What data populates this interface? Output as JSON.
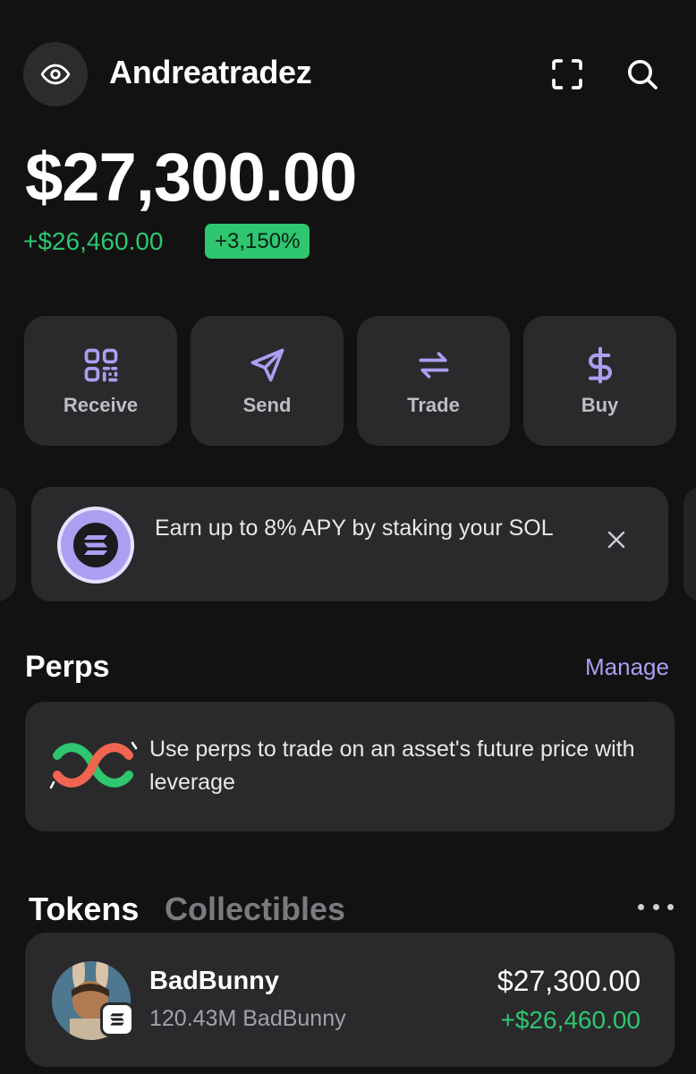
{
  "header": {
    "username": "Andreatradez"
  },
  "balance": {
    "total": "$27,300.00",
    "change_amount": "+$26,460.00",
    "change_percent": "+3,150%"
  },
  "actions": [
    {
      "label": "Receive",
      "icon": "qr-code-icon"
    },
    {
      "label": "Send",
      "icon": "send-icon"
    },
    {
      "label": "Trade",
      "icon": "swap-icon"
    },
    {
      "label": "Buy",
      "icon": "dollar-icon"
    }
  ],
  "promo": {
    "text": "Earn up to 8% APY by staking your SOL"
  },
  "perps": {
    "title": "Perps",
    "manage_label": "Manage",
    "description": "Use perps to trade on an asset's future price with leverage"
  },
  "tabs": {
    "tokens": "Tokens",
    "collectibles": "Collectibles",
    "active": "Tokens"
  },
  "tokens": [
    {
      "name": "BadBunny",
      "amount": "120.43M BadBunny",
      "value": "$27,300.00",
      "change": "+$26,460.00"
    }
  ],
  "colors": {
    "background": "#121212",
    "card": "#2a2a2c",
    "accent": "#ab9ff2",
    "positive": "#2ec66f"
  }
}
